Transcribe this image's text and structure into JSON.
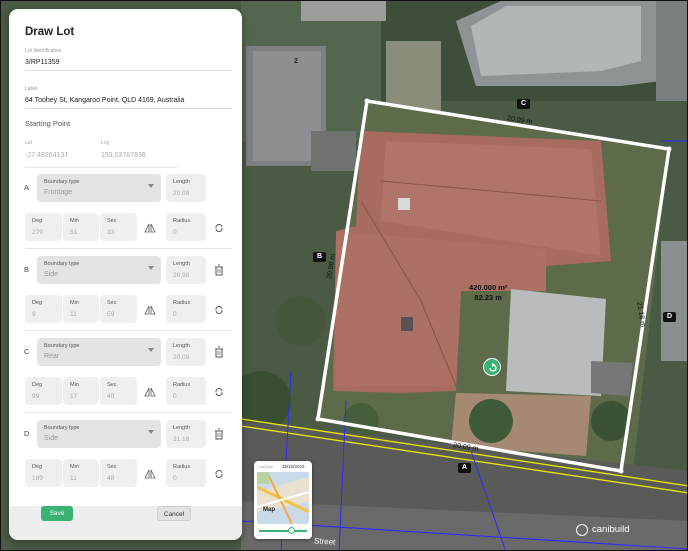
{
  "panel": {
    "title": "Draw Lot",
    "lot_identification_label": "Lot Identification",
    "lot_identification_value": "3/RP11359",
    "label_label": "Label",
    "label_value": "64 Toohey St, Kangaroo Point, QLD 4169, Australia",
    "starting_point_title": "Starting Point",
    "lat_label": "Lat",
    "lat_value": "-27.48264131",
    "lng_label": "Lng",
    "lng_value": "153.03767836"
  },
  "boundaries": [
    {
      "letter": "A",
      "type_label": "Boundary type",
      "type_value": "Frontage",
      "length_label": "Length",
      "length_value": "20.09",
      "deg_label": "Deg",
      "deg_value": "279",
      "min_label": "Min",
      "min_value": "51",
      "sec_label": "Sec",
      "sec_value": "33",
      "radius_label": "Radius",
      "radius_value": "0",
      "deletable": false
    },
    {
      "letter": "B",
      "type_label": "Boundary type",
      "type_value": "Side",
      "length_label": "Length",
      "length_value": "20.98",
      "deg_label": "Deg",
      "deg_value": "9",
      "min_label": "Min",
      "min_value": "11",
      "sec_label": "Sec",
      "sec_value": "59",
      "radius_label": "Radius",
      "radius_value": "0",
      "deletable": true
    },
    {
      "letter": "C",
      "type_label": "Boundary type",
      "type_value": "Rear",
      "length_label": "Length",
      "length_value": "20.09",
      "deg_label": "Deg",
      "deg_value": "99",
      "min_label": "Min",
      "min_value": "17",
      "sec_label": "Sec",
      "sec_value": "40",
      "radius_label": "Radius",
      "radius_value": "0",
      "deletable": true
    },
    {
      "letter": "D",
      "type_label": "Boundary type",
      "type_value": "Side",
      "length_label": "Length",
      "length_value": "21.18",
      "deg_label": "Deg",
      "deg_value": "189",
      "min_label": "Min",
      "min_value": "11",
      "sec_label": "Sec",
      "sec_value": "48",
      "radius_label": "Radius",
      "radius_value": "0",
      "deletable": true
    }
  ],
  "footer": {
    "save_label": "Save",
    "cancel_label": "Cancel"
  },
  "map": {
    "lot_number": "2",
    "vertex_labels": [
      "A",
      "B",
      "C",
      "D"
    ],
    "dim_top": "20.09 m",
    "dim_left": "20.98 m",
    "dim_right": "21.18 m",
    "dim_bottom": "20.09 m",
    "area_line1": "420.000 m²",
    "area_line2": "82.23 m",
    "street_label": "Street"
  },
  "mini_map": {
    "date_label": "Img Date",
    "date_value": "25/10/2023",
    "label": "Map"
  },
  "brand": {
    "name": "canibuild"
  },
  "colors": {
    "accent": "#3bb273",
    "boundary": "#ffffff",
    "road_line": "#e6e600",
    "cadastre_line": "#2b2bff"
  }
}
